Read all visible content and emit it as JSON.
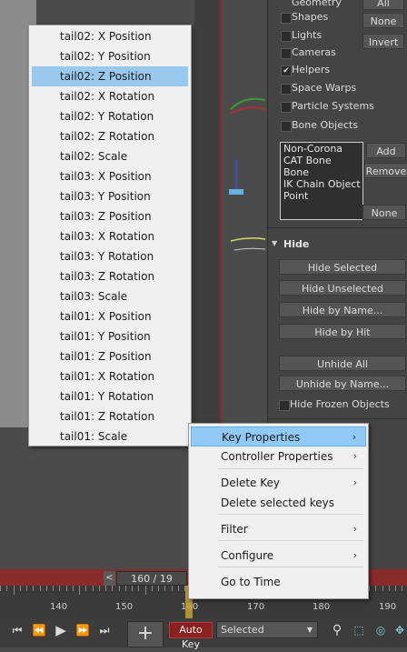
{
  "panel": {
    "top_label": "Geometry",
    "categories": [
      {
        "label": "Shapes",
        "checked": false
      },
      {
        "label": "Lights",
        "checked": false
      },
      {
        "label": "Cameras",
        "checked": false
      },
      {
        "label": "Helpers",
        "checked": true
      },
      {
        "label": "Space Warps",
        "checked": false
      },
      {
        "label": "Particle Systems",
        "checked": false
      },
      {
        "label": "Bone Objects",
        "checked": false
      }
    ],
    "all_btn": "All",
    "none_btn": "None",
    "invert_btn": "Invert",
    "list_items": [
      "Non-Corona",
      "CAT Bone",
      "Bone",
      "IK Chain Object",
      "Point"
    ],
    "add_btn": "Add",
    "remove_btn": "Remove",
    "none_btn2": "None",
    "hide_section": "Hide",
    "hide_buttons": [
      "Hide Selected",
      "Hide Unselected",
      "Hide by Name...",
      "Hide by Hit"
    ],
    "unhide_buttons": [
      "Unhide All",
      "Unhide by Name..."
    ],
    "hide_frozen_label": "Hide Frozen Objects",
    "check_mark": "✔"
  },
  "tracks": [
    "tail02: X Position",
    "tail02: Y Position",
    "tail02: Z Position",
    "tail02: X Rotation",
    "tail02: Y Rotation",
    "tail02: Z Rotation",
    "tail02: Scale",
    "tail03: X Position",
    "tail03: Y Position",
    "tail03: Z Position",
    "tail03: X Rotation",
    "tail03: Y Rotation",
    "tail03: Z Rotation",
    "tail03: Scale",
    "tail01: X Position",
    "tail01: Y Position",
    "tail01: Z Position",
    "tail01: X Rotation",
    "tail01: Y Rotation",
    "tail01: Z Rotation",
    "tail01: Scale"
  ],
  "selected_track_index": 2,
  "context_menu": {
    "items": [
      {
        "label": "Key Properties",
        "submenu": true,
        "highlighted": true
      },
      {
        "label": "Controller Properties",
        "submenu": true,
        "highlighted": false
      },
      {
        "label": "Delete Key",
        "submenu": true,
        "highlighted": false
      },
      {
        "label": "Delete selected keys",
        "submenu": false,
        "highlighted": false
      },
      {
        "label": "Filter",
        "submenu": true,
        "highlighted": false
      },
      {
        "label": "Configure",
        "submenu": true,
        "highlighted": false
      },
      {
        "label": "Go to Time",
        "submenu": false,
        "highlighted": false
      }
    ],
    "submenu_arrow": "›"
  },
  "timeline": {
    "frame_display": "160 / 19",
    "prev_arrow": "<",
    "ruler_labels": [
      "140",
      "150",
      "160",
      "170",
      "180",
      "190"
    ],
    "current_frame": 160
  },
  "bottombar": {
    "auto_key": "Auto Key",
    "selection_mode": "Selected",
    "dropdown_arrow": "▼"
  },
  "icons": {
    "playback": [
      "go-to-start-icon",
      "prev-frame-icon",
      "play-icon",
      "next-frame-icon",
      "go-to-end-icon"
    ],
    "add_key": "add-key-icon",
    "search": "search-icon"
  },
  "colors": {
    "selection": "#99c9ef",
    "menu_highlight": "#91c9f7",
    "auto_key_red": "#8b2020",
    "timeline_red": "#8b2a2a"
  }
}
